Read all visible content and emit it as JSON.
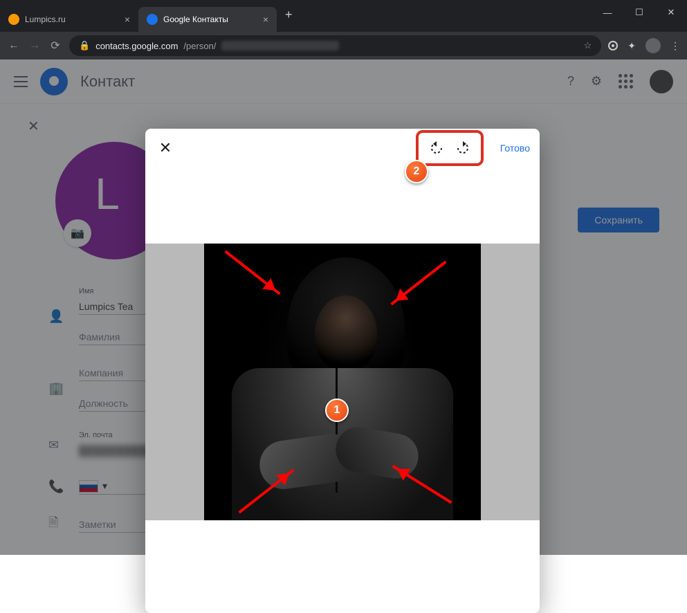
{
  "browser": {
    "tabs": [
      {
        "title": "Lumpics.ru",
        "active": false
      },
      {
        "title": "Google Контакты",
        "active": true
      }
    ],
    "url_host": "contacts.google.com",
    "url_path": "/person/"
  },
  "app": {
    "title": "Контакт",
    "save_button": "Сохранить",
    "avatar_letter": "L"
  },
  "fields": {
    "name_label": "Имя",
    "name_value": "Lumpics Tea",
    "surname_placeholder": "Фамилия",
    "company_placeholder": "Компания",
    "position_placeholder": "Должность",
    "email_label": "Эл. почта",
    "notes_placeholder": "Заметки"
  },
  "dialog": {
    "done_label": "Готово",
    "rotate_left_name": "rotate-left",
    "rotate_right_name": "rotate-right"
  },
  "annotations": {
    "one": "1",
    "two": "2"
  }
}
